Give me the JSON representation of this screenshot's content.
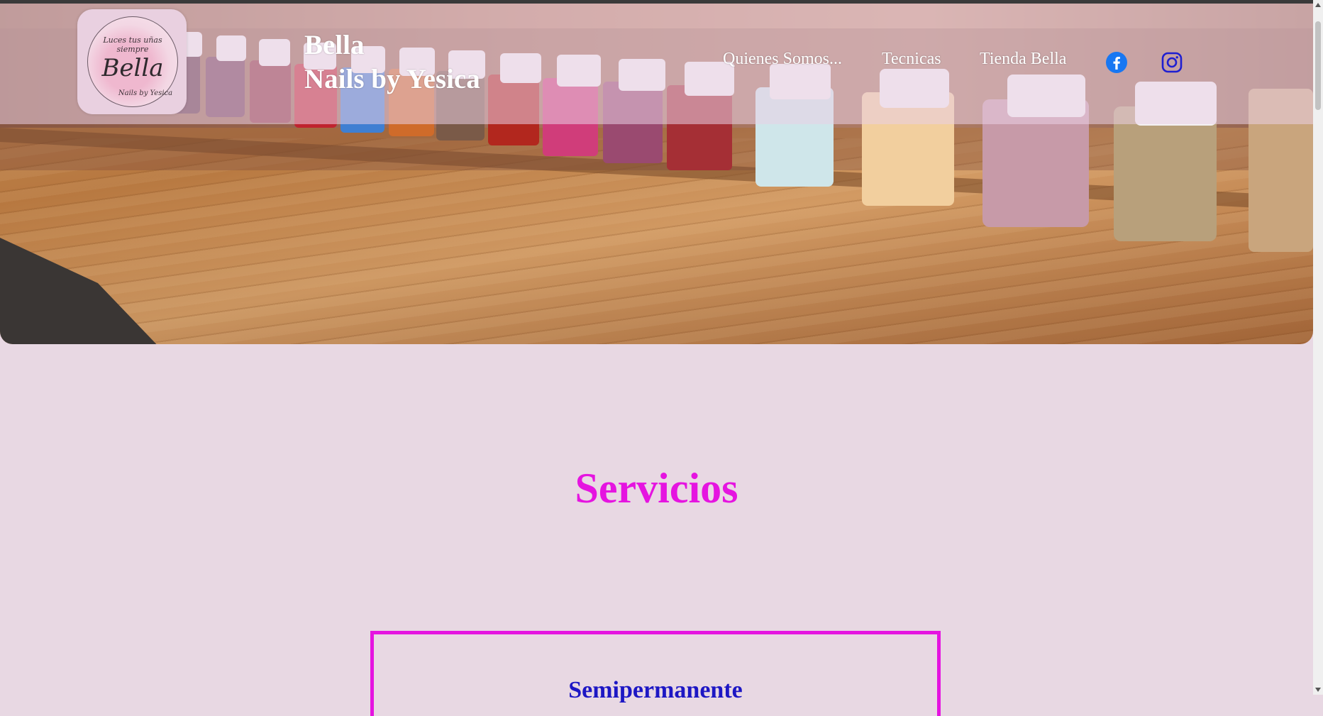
{
  "logo": {
    "tagline": "Luces tus uñas siempre",
    "name": "Bella",
    "subline": "Nails by Yesica"
  },
  "brand": {
    "line1": "Bella",
    "line2": "Nails by Yesica"
  },
  "nav": {
    "items": [
      {
        "label": "Quienes Somos..."
      },
      {
        "label": "Tecnicas"
      },
      {
        "label": "Tienda Bella"
      }
    ]
  },
  "social": {
    "facebook_icon": "facebook-icon",
    "instagram_icon": "instagram-icon"
  },
  "main": {
    "section_title": "Servicios",
    "card_title": "Semipermanente"
  },
  "colors": {
    "accent": "#e514e0",
    "card_title": "#1d17c4",
    "icons": "#1877f2",
    "background": "#e8d8e3"
  }
}
